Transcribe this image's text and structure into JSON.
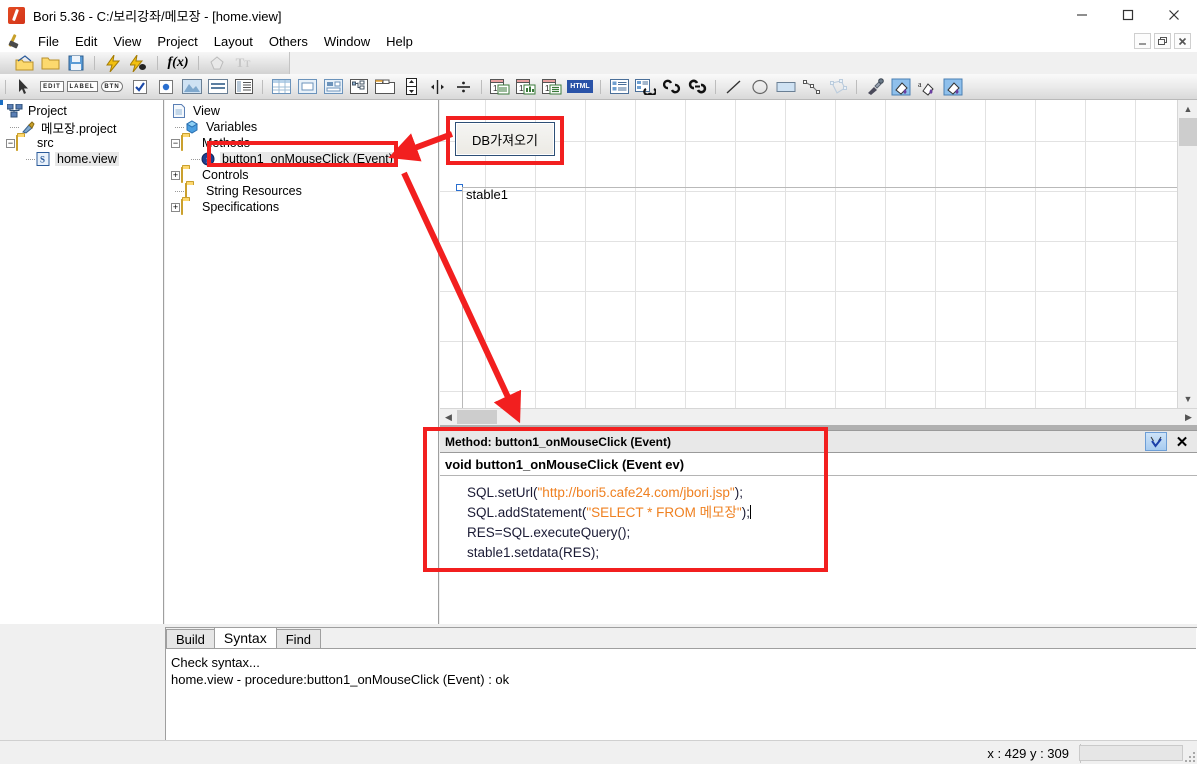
{
  "window": {
    "title": "Bori 5.36 - C:/보리강좌/메모장 - [home.view]",
    "app_icon": "bori-feather-icon",
    "minimize": "minimize-icon",
    "maximize": "maximize-icon",
    "close": "close-icon"
  },
  "menu": {
    "icon": "bori-small-icon",
    "items": [
      "File",
      "Edit",
      "View",
      "Project",
      "Layout",
      "Others",
      "Window",
      "Help"
    ],
    "mdi_buttons": [
      "_",
      "❐",
      "✕"
    ]
  },
  "toolbar1": {
    "items": [
      {
        "name": "new-project-icon",
        "glyph": "folder-new"
      },
      {
        "name": "open-folder-icon",
        "glyph": "folder-open"
      },
      {
        "name": "save-icon",
        "glyph": "floppy"
      },
      {
        "name": "separator",
        "glyph": "sep"
      },
      {
        "name": "run-icon",
        "glyph": "bolt"
      },
      {
        "name": "debug-icon",
        "glyph": "bolt-bug"
      },
      {
        "name": "separator",
        "glyph": "sep"
      },
      {
        "name": "function-icon",
        "glyph": "fx"
      },
      {
        "name": "separator",
        "glyph": "sep"
      },
      {
        "name": "shape-icon",
        "glyph": "pentagon-disabled"
      },
      {
        "name": "text-tool-icon",
        "glyph": "TT-disabled"
      }
    ]
  },
  "toolbar2": {
    "items": [
      {
        "name": "separator",
        "glyph": "sep"
      },
      {
        "name": "pointer-tool",
        "glyph": "arrow"
      },
      {
        "name": "edit-control-tool",
        "glyph": "EDIT"
      },
      {
        "name": "label-control-tool",
        "glyph": "LABEL"
      },
      {
        "name": "button-control-tool",
        "glyph": "BTN"
      },
      {
        "name": "checkbox-control-tool",
        "glyph": "check"
      },
      {
        "name": "radio-control-tool",
        "glyph": "radio"
      },
      {
        "name": "image-control-tool",
        "glyph": "image"
      },
      {
        "name": "listbox-control-tool",
        "glyph": "lines"
      },
      {
        "name": "combo-control-tool",
        "glyph": "list-detail"
      },
      {
        "name": "separator",
        "glyph": "sep"
      },
      {
        "name": "grid-control-tool",
        "glyph": "grid"
      },
      {
        "name": "simple-table-tool",
        "glyph": "grid-box"
      },
      {
        "name": "table-layout-tool",
        "glyph": "grid-split"
      },
      {
        "name": "tree-control-tool",
        "glyph": "tree"
      },
      {
        "name": "tab-control-tool",
        "glyph": "tabs"
      },
      {
        "name": "vertical-split-tool",
        "glyph": "vsplit"
      },
      {
        "name": "horizontal-split-tool",
        "glyph": "hsplit"
      },
      {
        "name": "align-center-tool",
        "glyph": "divide"
      },
      {
        "name": "separator",
        "glyph": "sep"
      },
      {
        "name": "calendar-control-tool",
        "glyph": "cal1"
      },
      {
        "name": "chart-control-tool",
        "glyph": "cal2"
      },
      {
        "name": "report-control-tool",
        "glyph": "cal3"
      },
      {
        "name": "html-control-tool",
        "glyph": "HTML"
      },
      {
        "name": "separator",
        "glyph": "sep"
      },
      {
        "name": "dataset-tool",
        "glyph": "dataset"
      },
      {
        "name": "data-link-tool",
        "glyph": "data-link"
      },
      {
        "name": "link-tool",
        "glyph": "chain1"
      },
      {
        "name": "link-tool-2",
        "glyph": "chain2"
      },
      {
        "name": "separator",
        "glyph": "sep"
      },
      {
        "name": "line-tool",
        "glyph": "line"
      },
      {
        "name": "ellipse-tool",
        "glyph": "ellipse"
      },
      {
        "name": "rectangle-tool",
        "glyph": "rect"
      },
      {
        "name": "polyline-tool",
        "glyph": "polyline"
      },
      {
        "name": "polygon-tool",
        "glyph": "polygon-disabled"
      },
      {
        "name": "separator",
        "glyph": "sep"
      },
      {
        "name": "eyedropper-tool",
        "glyph": "eyedropper"
      },
      {
        "name": "fill-color-tool",
        "glyph": "bucket1"
      },
      {
        "name": "text-color-tool",
        "glyph": "bucket2"
      },
      {
        "name": "border-color-tool",
        "glyph": "bucket3"
      }
    ]
  },
  "project_tree": {
    "nodes": [
      {
        "label": "Project",
        "icon": "project-root-icon",
        "level": 0,
        "expander": "none"
      },
      {
        "label": "메모장.project",
        "icon": "project-file-icon",
        "level": 1,
        "expander": "none"
      },
      {
        "label": "src",
        "icon": "folder-icon",
        "level": 1,
        "expander": "minus"
      },
      {
        "label": "home.view",
        "icon": "view-file-icon",
        "level": 2,
        "expander": "none",
        "selected": true
      }
    ]
  },
  "view_tree": {
    "nodes": [
      {
        "label": "View",
        "icon": "view-doc-icon",
        "level": 0,
        "expander": "none"
      },
      {
        "label": "Variables",
        "icon": "variables-icon",
        "level": 1,
        "expander": "none"
      },
      {
        "label": "Methods",
        "icon": "folder-icon",
        "level": 1,
        "expander": "minus"
      },
      {
        "label": "button1_onMouseClick (Event)",
        "icon": "method-event-icon",
        "level": 2,
        "expander": "none",
        "selected": true
      },
      {
        "label": "Controls",
        "icon": "folder-icon",
        "level": 1,
        "expander": "plus"
      },
      {
        "label": "String Resources",
        "icon": "folder-icon",
        "level": 1,
        "expander": "none"
      },
      {
        "label": "Specifications",
        "icon": "folder-icon",
        "level": 1,
        "expander": "plus"
      }
    ]
  },
  "canvas": {
    "button_label": "DB가져오기",
    "table_label": "stable1"
  },
  "method_editor": {
    "header": "Method: button1_onMouseClick (Event)",
    "signature": "void button1_onMouseClick (Event ev)",
    "syntax_check_icon": "syntax-check-icon",
    "close_icon": "close-icon",
    "code_lines": [
      [
        {
          "t": "SQL.setUrl(",
          "c": "plain"
        },
        {
          "t": "\"http://bori5.cafe24.com/jbori.jsp\"",
          "c": "string"
        },
        {
          "t": ");",
          "c": "plain"
        }
      ],
      [
        {
          "t": "SQL.addStatement(",
          "c": "plain"
        },
        {
          "t": "\"SELECT * FROM 메모장\"",
          "c": "string"
        },
        {
          "t": ");",
          "c": "plain"
        },
        {
          "t": "|",
          "c": "caret"
        }
      ],
      [
        {
          "t": "RES=SQL.executeQuery();",
          "c": "plain"
        }
      ],
      [
        {
          "t": "stable1.setdata(RES);",
          "c": "plain"
        }
      ]
    ]
  },
  "output_panel": {
    "tabs": [
      {
        "label": "Build",
        "active": false
      },
      {
        "label": "Syntax",
        "active": true
      },
      {
        "label": "Find",
        "active": false
      }
    ],
    "lines": [
      "Check syntax...",
      "home.view - procedure:button1_onMouseClick (Event) : ok"
    ]
  },
  "statusbar": {
    "coords": "x : 429  y : 309"
  },
  "annotations": {
    "color": "#f21f1f",
    "boxes": [
      "method-tree-item-highlight",
      "db-button-highlight",
      "code-block-highlight"
    ],
    "arrows": [
      "arrow-to-tree-item",
      "arrow-to-code-panel"
    ]
  }
}
